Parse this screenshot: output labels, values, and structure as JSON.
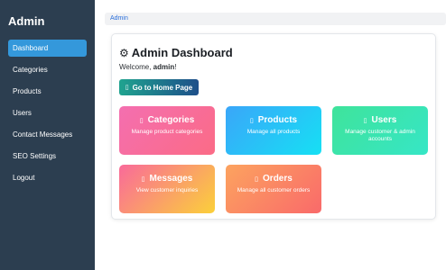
{
  "sidebar": {
    "brand": "Admin",
    "items": [
      {
        "label": "Dashboard",
        "active": true
      },
      {
        "label": "Categories"
      },
      {
        "label": "Products"
      },
      {
        "label": "Users"
      },
      {
        "label": "Contact Messages"
      },
      {
        "label": "SEO Settings"
      },
      {
        "label": "Logout"
      }
    ]
  },
  "breadcrumb": "Admin",
  "dashboard": {
    "title": "Admin Dashboard",
    "welcome_prefix": "Welcome, ",
    "username": "admin",
    "welcome_suffix": "!",
    "home_button": "Go to Home Page"
  },
  "tiles": [
    {
      "title": "Categories",
      "desc": "Manage product categories"
    },
    {
      "title": "Products",
      "desc": "Manage all products"
    },
    {
      "title": "Users",
      "desc": "Manage customer & admin accounts"
    },
    {
      "title": "Messages",
      "desc": "View customer inquiries"
    },
    {
      "title": "Orders",
      "desc": "Manage all customer orders"
    }
  ],
  "icons": {
    "title": "gear-icon",
    "home_button": "home-icon",
    "tiles": [
      "tag-icon",
      "box-icon",
      "users-icon",
      "envelope-icon",
      "cart-icon"
    ]
  },
  "colors": {
    "sidebar_bg": "#2c3e50",
    "active_item": "#3498db",
    "link": "#2a6fdb"
  }
}
